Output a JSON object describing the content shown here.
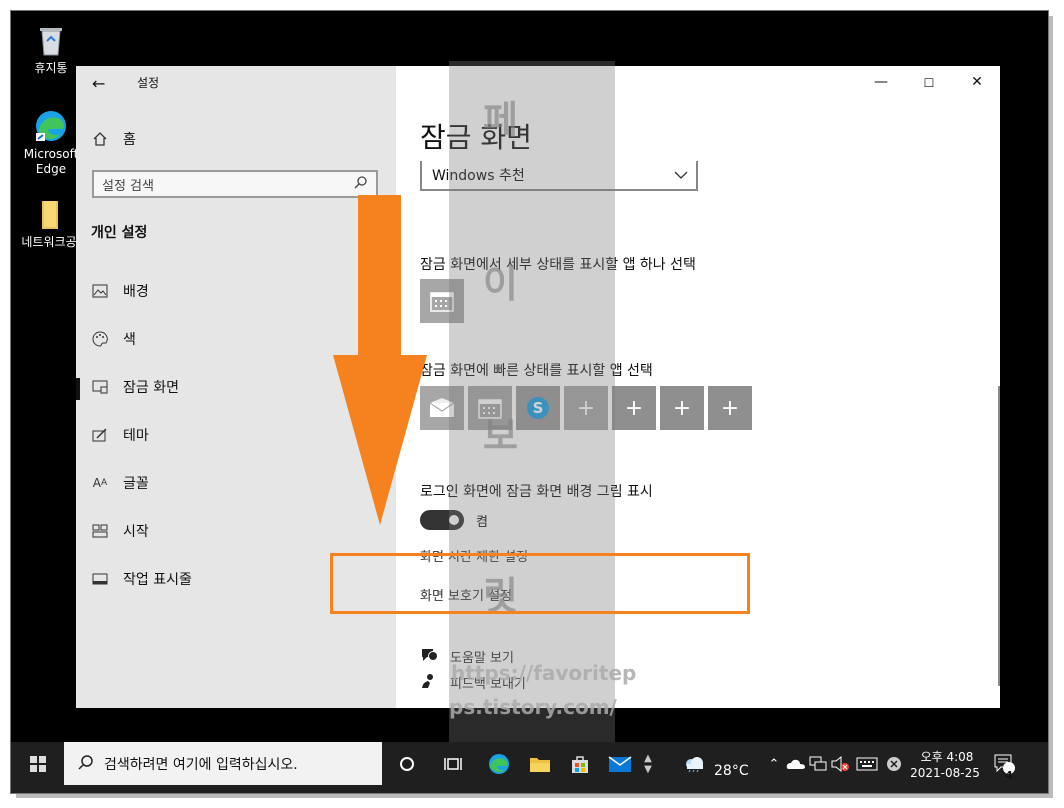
{
  "desktop": {
    "icons": [
      {
        "label": "휴지통"
      },
      {
        "label": "Microsoft Edge"
      },
      {
        "label": "네트워크공"
      }
    ]
  },
  "window": {
    "app_title": "설정",
    "controls": {
      "minimize": "—",
      "maximize": "☐",
      "close": "✕"
    }
  },
  "sidebar": {
    "home": "홈",
    "search_placeholder": "설정 검색",
    "section": "개인 설정",
    "items": [
      {
        "label": "배경"
      },
      {
        "label": "색"
      },
      {
        "label": "잠금 화면"
      },
      {
        "label": "테마"
      },
      {
        "label": "글꼴"
      },
      {
        "label": "시작"
      },
      {
        "label": "작업 표시줄"
      }
    ]
  },
  "main": {
    "title": "잠금 화면",
    "dropdown_value": "Windows 추천",
    "detail_label": "잠금 화면에서 세부 상태를 표시할 앱 하나 선택",
    "quick_label": "잠금 화면에 빠른 상태를 표시할 앱 선택",
    "signin_label": "로그인 화면에 잠금 화면 배경 그림 표시",
    "toggle_state": "켬",
    "timeout_link": "화면 시간 제한 설정",
    "screensaver_link": "화면 보호기 설정",
    "help": "도움말 보기",
    "feedback": "피드백 보내기"
  },
  "overlay": {
    "watermark_chars": [
      "페",
      "이",
      "보",
      "릿"
    ],
    "url_line1": "https://favoritep",
    "url_line2": "ps.tistory.com/",
    "arrow_color": "#f5821f",
    "highlight_color": "#f5821f"
  },
  "taskbar": {
    "search_placeholder": "검색하려면 여기에 입력하십시오.",
    "weather": "28°C",
    "time": "오후 4:08",
    "date": "2021-08-25",
    "notifications": "4"
  }
}
